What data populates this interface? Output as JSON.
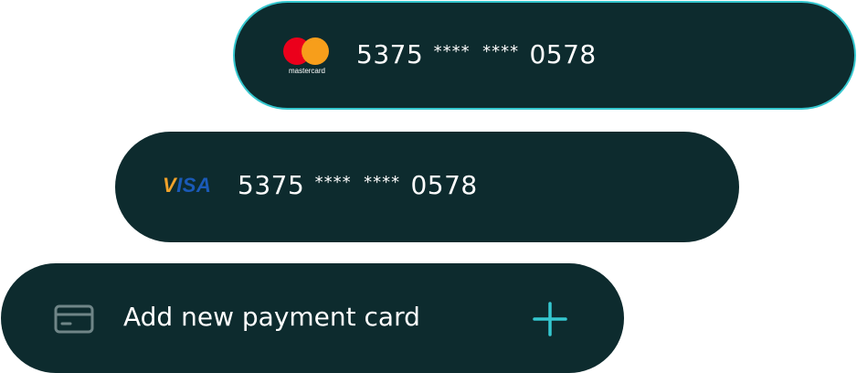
{
  "colors": {
    "card_background": "#0d2b2e",
    "selected_border": "#35c7cf",
    "accent_plus": "#35c7cf",
    "text": "#ffffff",
    "mastercard_red": "#eb001b",
    "mastercard_yellow": "#f79e1b",
    "visa_blue": "#1a5ab8",
    "visa_gold": "#f0a22a"
  },
  "cards": [
    {
      "brand": "mastercard",
      "brand_logo_text": "mastercard",
      "number_first": "5375",
      "number_mask_1": "****",
      "number_mask_2": "****",
      "number_last": "0578",
      "selected": true
    },
    {
      "brand": "visa",
      "brand_logo_text": "VISA",
      "number_first": "5375",
      "number_mask_1": "****",
      "number_mask_2": "****",
      "number_last": "0578",
      "selected": false
    }
  ],
  "add_card": {
    "label": "Add new payment card",
    "icon": "credit-card-icon",
    "action_icon": "plus-icon"
  }
}
